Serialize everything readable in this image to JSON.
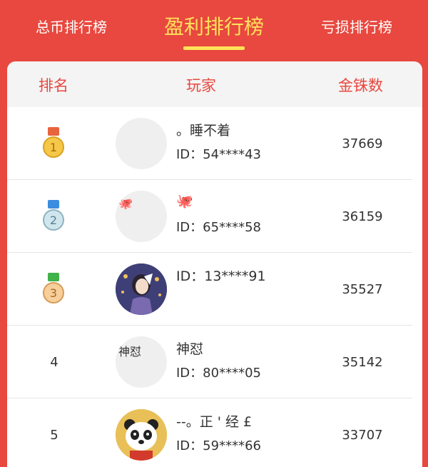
{
  "tabs": [
    {
      "label": "总币排行榜",
      "active": false
    },
    {
      "label": "盈利排行榜",
      "active": true
    },
    {
      "label": "亏损排行榜",
      "active": false
    }
  ],
  "colors": {
    "background": "#e8483f",
    "accent": "#ffe25a",
    "header_text": "#e8483f"
  },
  "table": {
    "headers": {
      "rank": "排名",
      "player": "玩家",
      "coins": "金铢数"
    },
    "rows": [
      {
        "rank": "1",
        "medal": "gold-medal",
        "nickname": "。睡不着",
        "id": "ID：54****43",
        "coins": "37669",
        "avatar_text": ""
      },
      {
        "rank": "2",
        "medal": "silver-medal",
        "nickname": "🐙",
        "id": "ID：65****58",
        "coins": "36159",
        "avatar_text": "🐙"
      },
      {
        "rank": "3",
        "medal": "bronze-medal",
        "nickname": "",
        "id": "ID：13****91",
        "coins": "35527",
        "avatar_text": ""
      },
      {
        "rank": "4",
        "medal": "",
        "nickname": "神怼",
        "id": "ID：80****05",
        "coins": "35142",
        "avatar_text": "神怼"
      },
      {
        "rank": "5",
        "medal": "",
        "nickname": "--。正 ' 经 £",
        "id": "ID：59****66",
        "coins": "33707",
        "avatar_text": ""
      }
    ]
  }
}
